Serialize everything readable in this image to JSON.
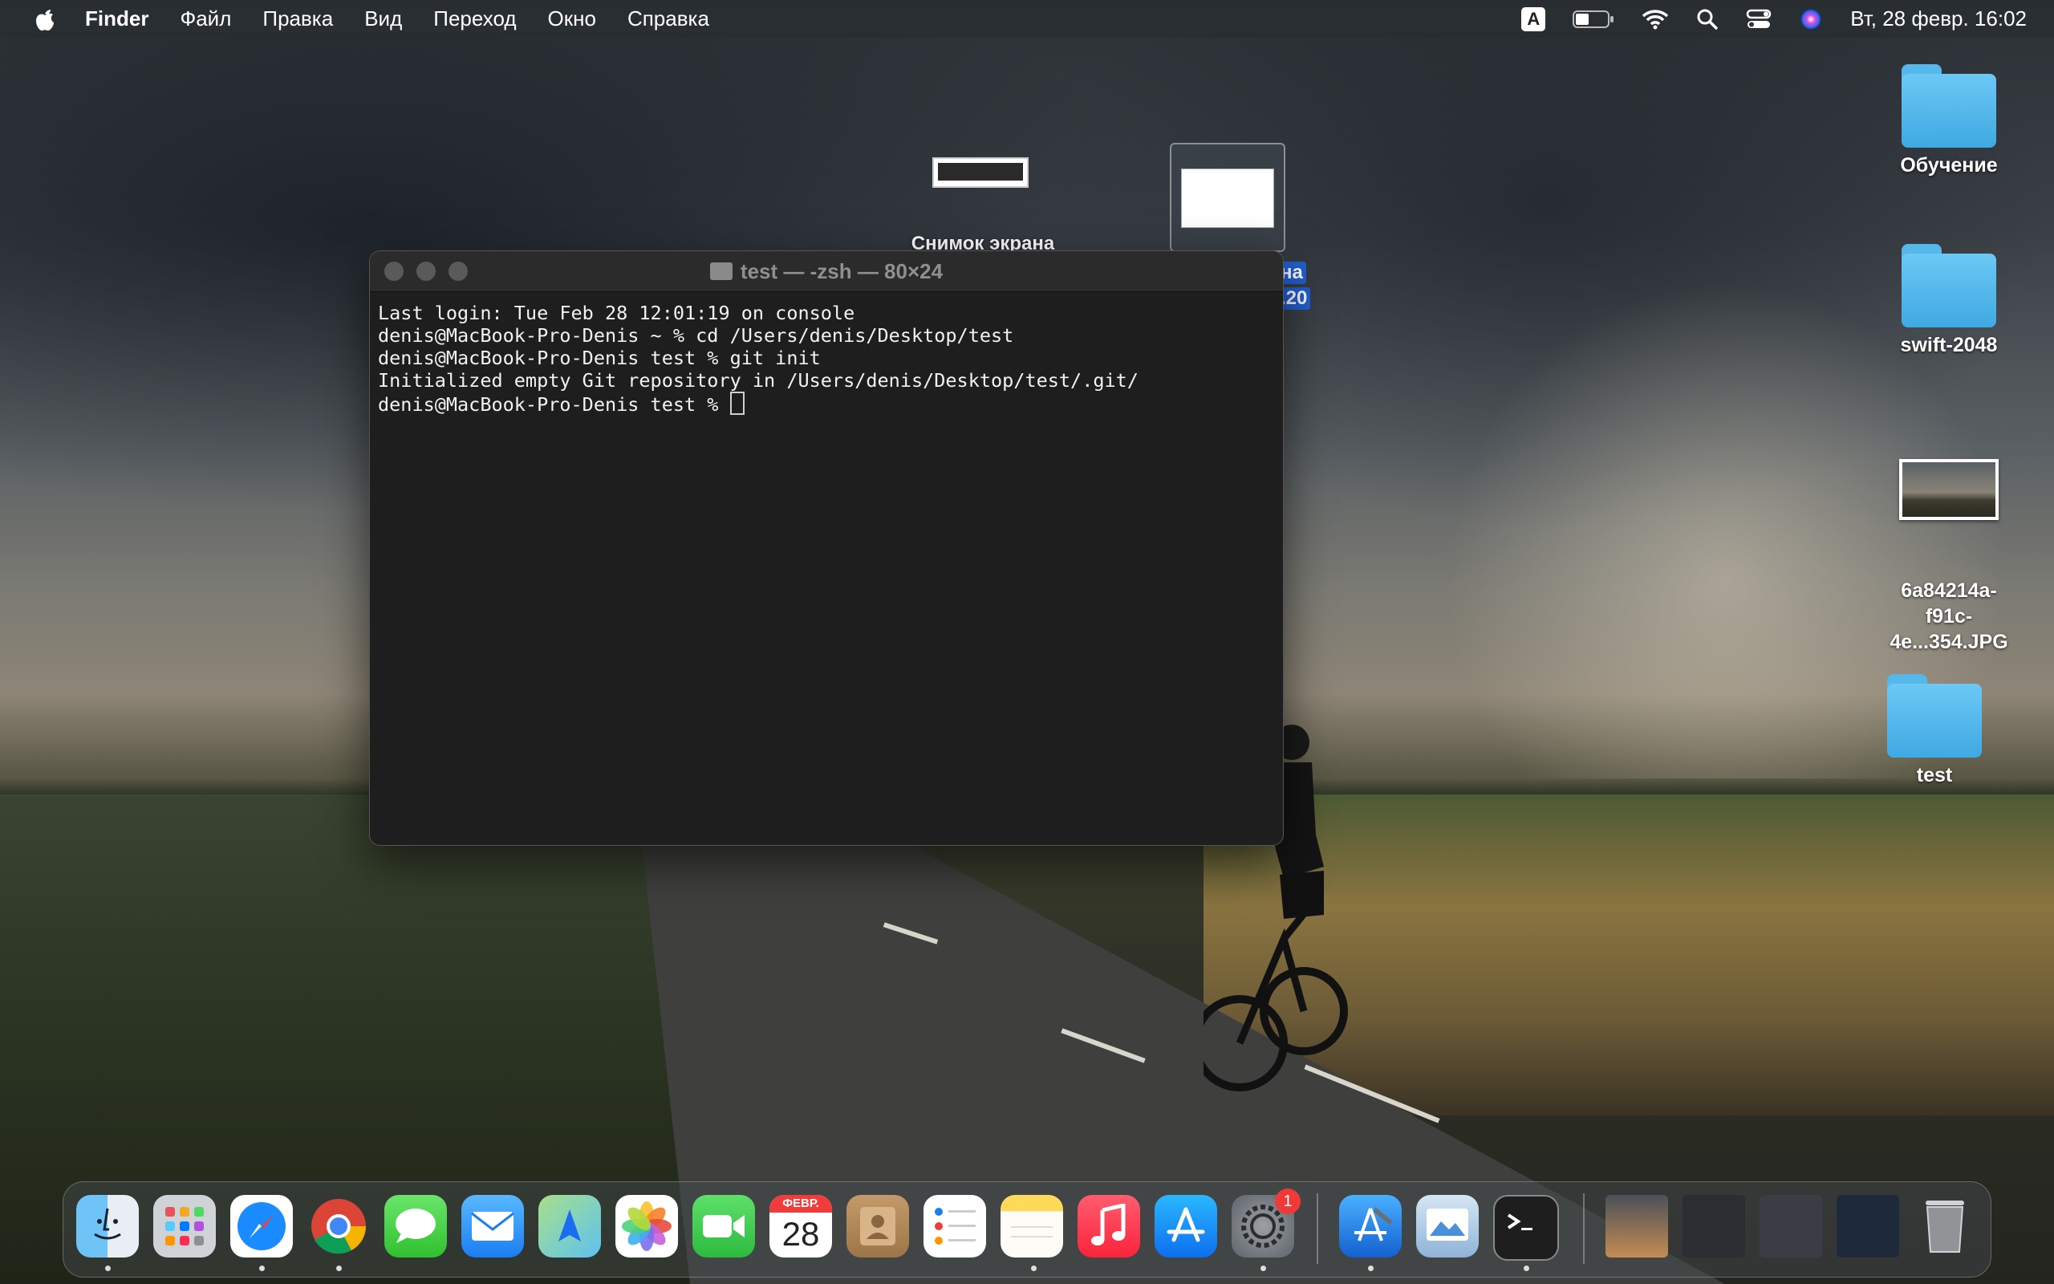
{
  "menubar": {
    "app_name": "Finder",
    "menus": [
      "Файл",
      "Правка",
      "Вид",
      "Переход",
      "Окно",
      "Справка"
    ],
    "input_source": "A",
    "datetime": "Вт, 28 февр.  16:02"
  },
  "desktop": {
    "items": [
      {
        "label": "Обучение",
        "kind": "folder"
      },
      {
        "label": "swift-2048",
        "kind": "folder"
      },
      {
        "label": "6a84214a-\nf91c-4e...354.JPG",
        "kind": "image"
      },
      {
        "label": "test",
        "kind": "folder"
      }
    ],
    "screenshot_label": "Снимок экрана",
    "selected_label_line1": "на",
    "selected_label_line2": ".20"
  },
  "terminal": {
    "title": "test — -zsh — 80×24",
    "lines": [
      "Last login: Tue Feb 28 12:01:19 on console",
      "denis@MacBook-Pro-Denis ~ % cd /Users/denis/Desktop/test",
      "denis@MacBook-Pro-Denis test % git init",
      "Initialized empty Git repository in /Users/denis/Desktop/test/.git/",
      "denis@MacBook-Pro-Denis test % "
    ]
  },
  "dock": {
    "calendar_month": "ФЕВР.",
    "calendar_day": "28",
    "settings_badge": "1",
    "apps": [
      "finder",
      "launchpad",
      "safari",
      "chrome",
      "messages",
      "mail",
      "maps",
      "photos",
      "facetime",
      "calendar",
      "contacts",
      "reminders",
      "notes",
      "music",
      "app-store",
      "system-settings",
      "xcode",
      "preview",
      "terminal"
    ]
  },
  "colors": {
    "folder": "#4fb4ea",
    "selection": "#2360d2",
    "terminal_bg": "#1e1e1e"
  }
}
